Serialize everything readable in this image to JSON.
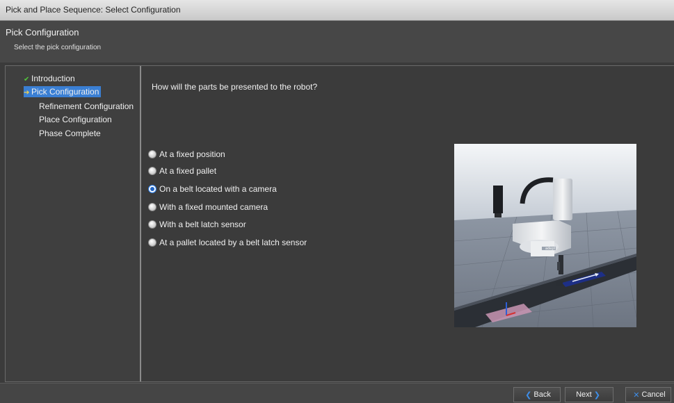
{
  "window": {
    "title": "Pick and Place Sequence: Select Configuration"
  },
  "header": {
    "title": "Pick Configuration",
    "subtitle": "Select the pick configuration"
  },
  "steps": [
    {
      "label": "Introduction",
      "state": "complete"
    },
    {
      "label": "Pick Configuration",
      "state": "current"
    },
    {
      "label": "Refinement Configuration",
      "state": "pending"
    },
    {
      "label": "Place Configuration",
      "state": "pending"
    },
    {
      "label": "Phase Complete",
      "state": "pending"
    }
  ],
  "question": "How will the parts be presented to the robot?",
  "options": [
    {
      "label": "At a fixed position",
      "selected": false
    },
    {
      "label": "At a fixed pallet",
      "selected": false
    },
    {
      "label": "On a belt located with a camera",
      "selected": true
    },
    {
      "label": "With a fixed mounted camera",
      "selected": false
    },
    {
      "label": "With a belt latch sensor",
      "selected": false
    },
    {
      "label": "At a pallet located by a belt latch sensor",
      "selected": false
    }
  ],
  "preview": {
    "robot_brand": "adept"
  },
  "footer": {
    "back_label": "Back",
    "next_label": "Next",
    "cancel_label": "Cancel"
  },
  "colors": {
    "selection": "#3a7fd4",
    "check": "#52c83c",
    "accent": "#2d7be0"
  },
  "icons": {
    "complete": "checkmark-icon",
    "current": "arrow-right-icon",
    "back": "chevron-left-icon",
    "next": "chevron-right-icon",
    "cancel": "close-icon"
  }
}
